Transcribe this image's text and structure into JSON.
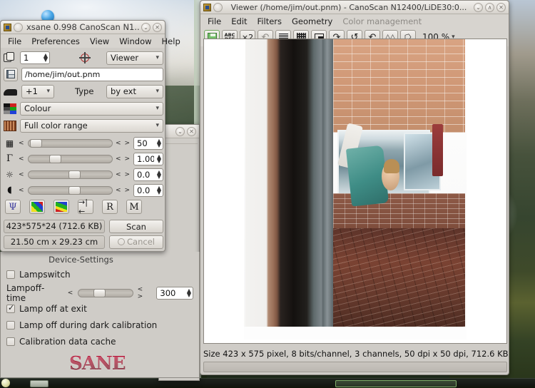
{
  "desktop": {
    "wallpaper_description": "mountain-landscape-wallpaper",
    "taskbar": {
      "items": []
    }
  },
  "background_window": {
    "minimize_label": "⌄",
    "close_label": "✕"
  },
  "xsane": {
    "title": "xsane 0.998 CanoScan N1...",
    "titlebar": {
      "minimize_label": "⌄",
      "close_label": "✕"
    },
    "menu": [
      "File",
      "Preferences",
      "View",
      "Window",
      "Help"
    ],
    "copies": {
      "value": "1",
      "icon": "copies-icon"
    },
    "target_combo": {
      "value": "Viewer",
      "icon": "target-icon"
    },
    "filename": {
      "value": "/home/jim/out.pnm",
      "icon": "save-icon"
    },
    "increment_combo": {
      "value": "+1",
      "icon": "shoe-icon"
    },
    "type_label": "Type",
    "type_combo": {
      "value": "by ext"
    },
    "colour_combo": {
      "value": "Colour",
      "icon": "color-mode-icon"
    },
    "range_combo": {
      "value": "Full color range",
      "icon": "film-icon"
    },
    "sliders": [
      {
        "name": "resolution",
        "icon": "resolution-icon",
        "value": "50",
        "knob_pct": 2
      },
      {
        "name": "gamma",
        "icon": "gamma-icon",
        "value": "1.00",
        "knob_pct": 25
      },
      {
        "name": "brightness",
        "icon": "brightness-icon",
        "value": "0.0",
        "knob_pct": 48
      },
      {
        "name": "contrast",
        "icon": "contrast-icon",
        "value": "0.0",
        "knob_pct": 48
      }
    ],
    "slider_arrows": "< >",
    "tool_icons": [
      "psi-icon",
      "histogram-icon",
      "gamma-curve-icon",
      "auto-level-icon",
      "reset-icon",
      "medium-icon"
    ],
    "tool_labels": [
      "Ψ",
      "",
      "",
      "→|←",
      "R",
      "M"
    ],
    "size_info": "423*575*24 (712.6 KB)",
    "dimension_info": "21.50 cm x 29.23 cm",
    "scan_button": "Scan",
    "cancel_button": "Cancel",
    "device_settings_title": "Device-Settings",
    "checkboxes": [
      {
        "label": "Lampswitch",
        "checked": false
      },
      {
        "label": "Lamp off at exit",
        "checked": true
      },
      {
        "label": "Lamp off during dark calibration",
        "checked": false
      },
      {
        "label": "Calibration data cache",
        "checked": false
      }
    ],
    "lampoff": {
      "label": "Lampoff-time",
      "value": "300",
      "arrows": "< >",
      "knob_pct": 28
    },
    "logo": "SANE"
  },
  "viewer": {
    "title": "Viewer (/home/jim/out.pnm) - CanoScan N12400/LiDE30:0...",
    "titlebar": {
      "minimize_label": "⌄",
      "maximize_label": "∧",
      "close_label": "✕"
    },
    "menu": [
      "File",
      "Edit",
      "Filters",
      "Geometry",
      "Color management"
    ],
    "menu_disabled": [
      "Color management"
    ],
    "toolbar": [
      {
        "name": "save-icon",
        "glyph": "■"
      },
      {
        "name": "ocr-icon",
        "glyph": "ABC"
      },
      {
        "name": "clone-icon",
        "glyph": "×2"
      },
      {
        "name": "undo-icon",
        "glyph": "↶"
      },
      {
        "name": "despeckle-icon",
        "glyph": "◤"
      },
      {
        "name": "blur-icon",
        "glyph": "⌗"
      },
      {
        "name": "scale-icon",
        "glyph": "◱"
      },
      {
        "name": "rotate-right-icon",
        "glyph": "↷"
      },
      {
        "name": "rotate-180-icon",
        "glyph": "↺"
      },
      {
        "name": "rotate-left-icon",
        "glyph": "↶"
      },
      {
        "name": "mirror-x-icon",
        "glyph": "△△"
      },
      {
        "name": "mirror-y-icon",
        "glyph": "⭔"
      }
    ],
    "zoom_combo": {
      "value": "100 %"
    },
    "status": "Size 423 x 575 pixel, 8 bits/channel, 3 channels, 50 dpi x 50 dpi, 712.6 KB",
    "image_alt": "scanned-photograph-child-by-brick-house"
  },
  "colors": {
    "window_bg": "#cfccc7",
    "titlebar": "#e3e0db",
    "entry_bg": "#ffffff",
    "accent_green": "#7fae6a",
    "sane_logo_red": "#9e1b32",
    "text": "#1a1a1a",
    "disabled_text": "#8d8a85"
  }
}
